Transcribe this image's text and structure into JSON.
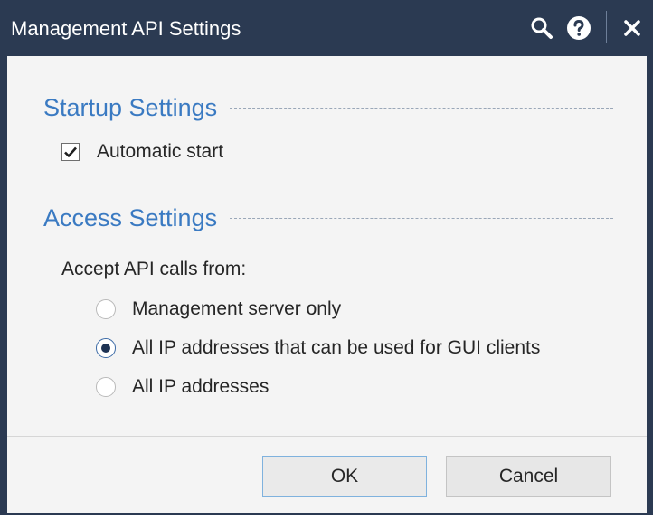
{
  "window": {
    "title": "Management API Settings",
    "icons": [
      "search-icon",
      "help-icon",
      "close-icon"
    ]
  },
  "startup": {
    "heading": "Startup Settings",
    "auto_start": {
      "label": "Automatic start",
      "checked": true
    }
  },
  "access": {
    "heading": "Access Settings",
    "prompt": "Accept API calls from:",
    "options": [
      {
        "label": "Management server only",
        "selected": false
      },
      {
        "label": "All IP addresses that can be used for GUI clients",
        "selected": true
      },
      {
        "label": "All IP addresses",
        "selected": false
      }
    ]
  },
  "footer": {
    "ok_label": "OK",
    "cancel_label": "Cancel"
  },
  "colors": {
    "titlebar": "#2b3a52",
    "heading": "#3a7ac2",
    "panel": "#f4f4f4"
  }
}
